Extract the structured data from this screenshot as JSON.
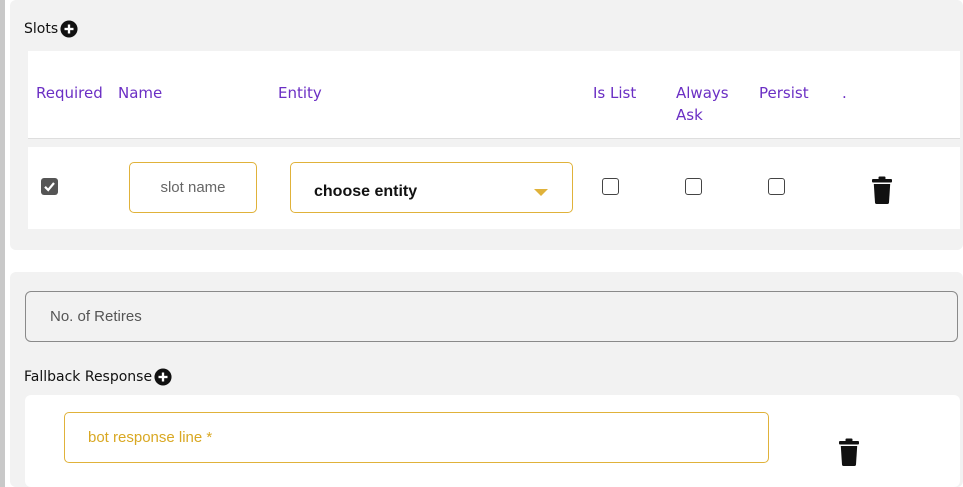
{
  "slots": {
    "title": "Slots",
    "columns": [
      "Required",
      "Name",
      "Entity",
      "Is List",
      "Always Ask",
      "Persist",
      "."
    ],
    "row": {
      "required_checked": true,
      "name_placeholder": "slot name",
      "entity_value": "choose entity",
      "is_list": false,
      "always_ask": false,
      "persist": false
    }
  },
  "retries": {
    "placeholder": "No. of Retires"
  },
  "fallback": {
    "title": "Fallback Response",
    "response_placeholder": "bot response line *"
  },
  "colors": {
    "header_text": "#6b2fc4",
    "accent_border": "#e0b23a"
  }
}
